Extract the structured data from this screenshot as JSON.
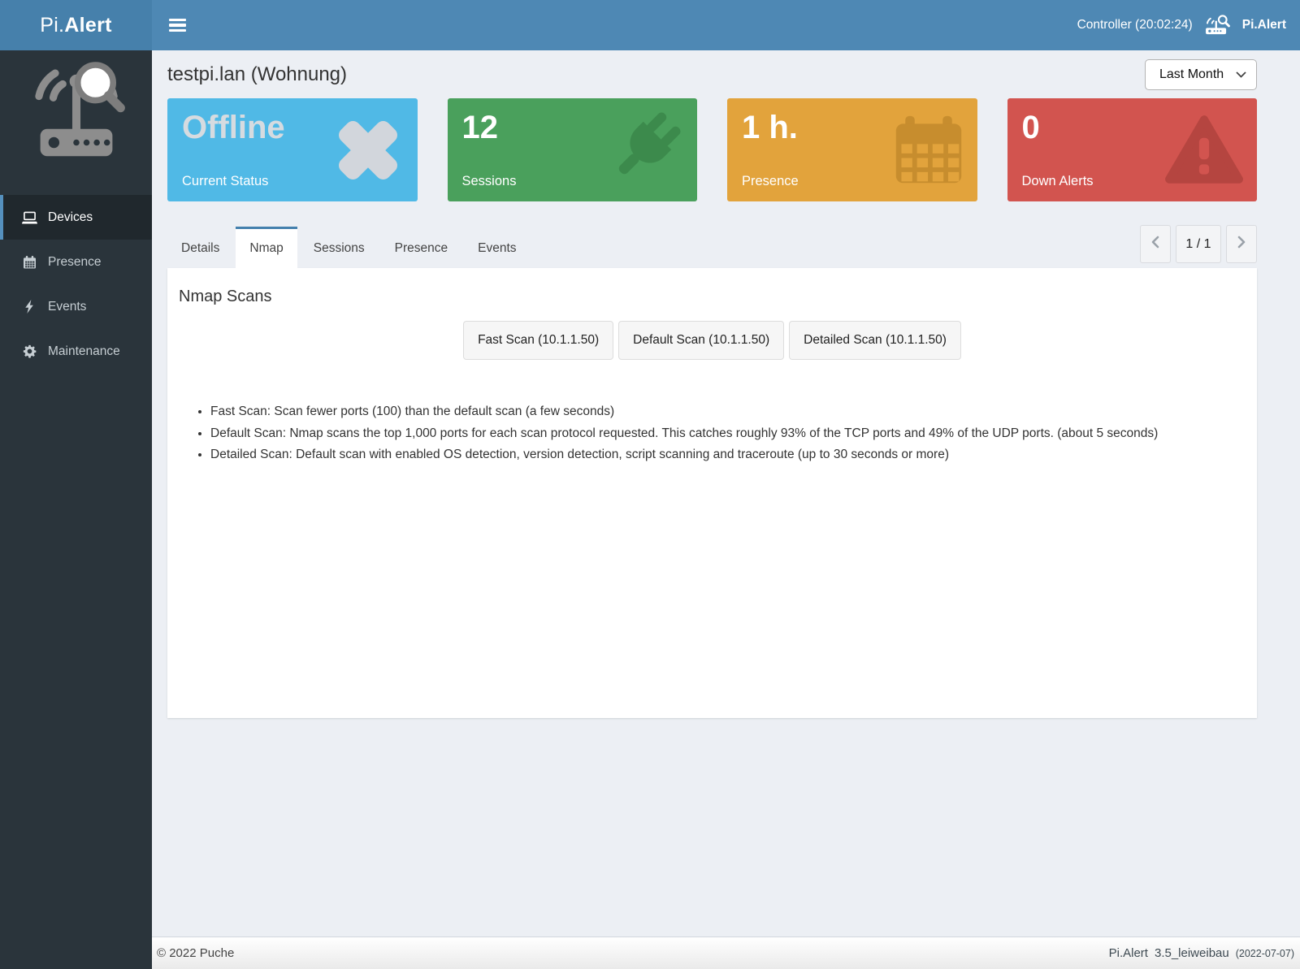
{
  "header": {
    "logo_prefix": "Pi.",
    "logo_suffix": "Alert",
    "controller_label": "Controller (20:02:24)",
    "brand": "Pi.Alert"
  },
  "sidebar": {
    "items": [
      {
        "label": "Devices",
        "icon": "laptop-icon",
        "active": true
      },
      {
        "label": "Presence",
        "icon": "calendar-icon",
        "active": false
      },
      {
        "label": "Events",
        "icon": "bolt-icon",
        "active": false
      },
      {
        "label": "Maintenance",
        "icon": "gear-icon",
        "active": false
      }
    ]
  },
  "page": {
    "title": "testpi.lan (Wohnung)",
    "period_selected": "Last Month",
    "cards": [
      {
        "value": "Offline",
        "label": "Current Status",
        "icon": "x-mark-icon",
        "bg": "#50b9e6",
        "value_color": "#d6dbe0",
        "icon_color": "#d2d6dc"
      },
      {
        "value": "12",
        "label": "Sessions",
        "icon": "plug-icon",
        "bg": "#4aa05c",
        "value_color": "#ffffff",
        "icon_color": "#3c8a4c"
      },
      {
        "value": "1 h.",
        "label": "Presence",
        "icon": "calendar-icon",
        "bg": "#e2a33c",
        "value_color": "#ffffff",
        "icon_color": "#c78d2e"
      },
      {
        "value": "0",
        "label": "Down Alerts",
        "icon": "warning-icon",
        "bg": "#d2544f",
        "value_color": "#ffffff",
        "icon_color": "#b54540"
      }
    ],
    "tabs": [
      "Details",
      "Nmap",
      "Sessions",
      "Presence",
      "Events"
    ],
    "active_tab": "Nmap",
    "pagination": {
      "current": "1 / 1"
    },
    "panel": {
      "heading": "Nmap Scans",
      "scan_buttons": [
        "Fast Scan (10.1.1.50)",
        "Default Scan (10.1.1.50)",
        "Detailed Scan (10.1.1.50)"
      ],
      "notes": [
        "Fast Scan: Scan fewer ports (100) than the default scan (a few seconds)",
        "Default Scan: Nmap scans the top 1,000 ports for each scan protocol requested. This catches roughly 93% of the TCP ports and 49% of the UDP ports. (about 5 seconds)",
        "Detailed Scan: Default scan with enabled OS detection, version detection, script scanning and traceroute (up to 30 seconds or more)"
      ]
    }
  },
  "footer": {
    "copyright": "© 2022 Puche",
    "brand": "Pi.Alert",
    "version": "3.5_leiweibau",
    "date": "(2022-07-07)"
  },
  "colors": {
    "navbar_bg": "#4e88b4",
    "logo_bg": "#4680ab",
    "sidebar_bg": "#2a343b",
    "content_bg": "#eceff4",
    "active_tab_border": "#4480ad"
  }
}
